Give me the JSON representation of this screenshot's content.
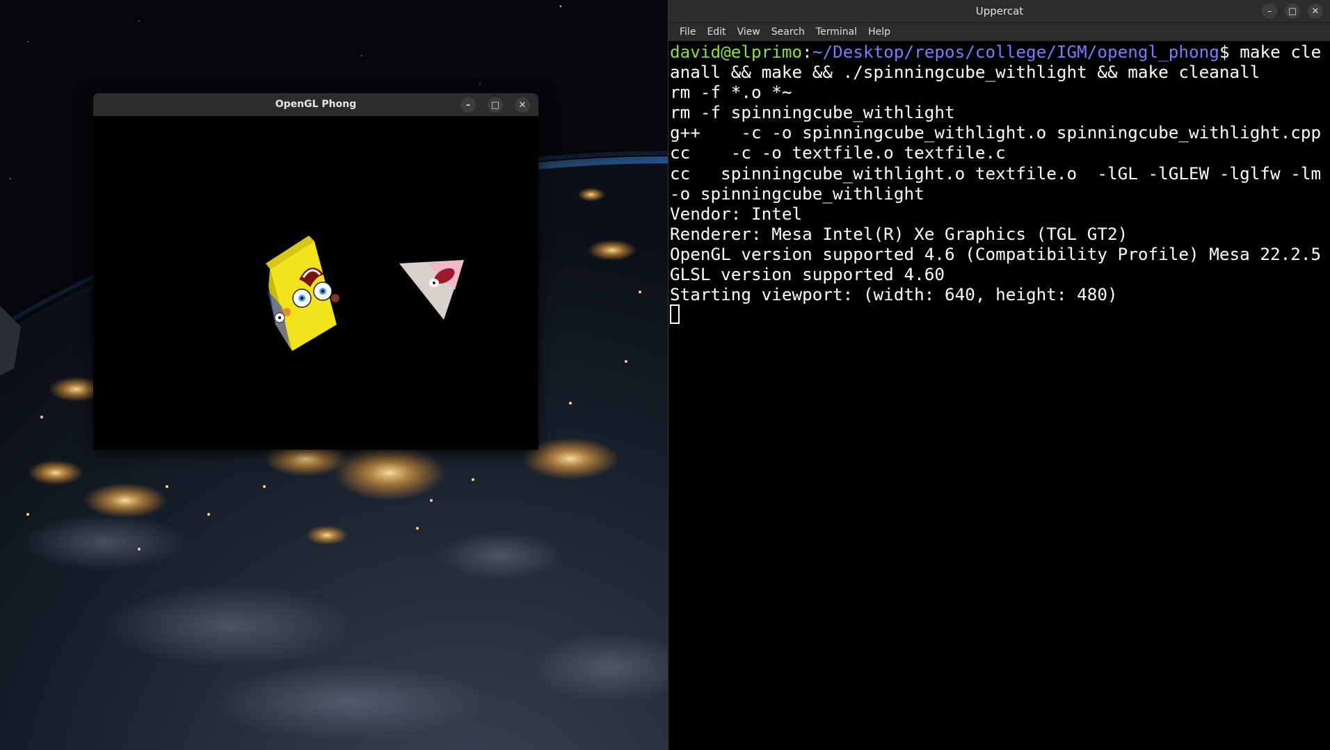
{
  "opengl_window": {
    "title": "OpenGL Phong",
    "minimize_icon": "minimize-icon",
    "maximize_icon": "maximize-icon",
    "close_icon": "close-icon"
  },
  "terminal_window": {
    "title": "Uppercat",
    "menu": [
      "File",
      "Edit",
      "View",
      "Search",
      "Terminal",
      "Help"
    ],
    "prompt": {
      "user": "david@elprimo",
      "path": "~/Desktop/repos/college/IGM/opengl_phong",
      "symbol": "$ ",
      "command": "make cleanall && make && ./spinningcube_withlight && make cleanall"
    },
    "output_lines": [
      "rm -f *.o *~",
      "rm -f spinningcube_withlight",
      "g++    -c -o spinningcube_withlight.o spinningcube_withlight.cpp",
      "cc    -c -o textfile.o textfile.c",
      "cc   spinningcube_withlight.o textfile.o  -lGL -lGLEW -lglfw -lm  -o spinningcube_withlight",
      "Vendor: Intel",
      "Renderer: Mesa Intel(R) Xe Graphics (TGL GT2)",
      "OpenGL version supported 4.6 (Compatibility Profile) Mesa 22.2.5",
      "GLSL version supported 4.60",
      "Starting viewport: (width: 640, height: 480)"
    ]
  },
  "colors": {
    "prompt_user": "#8ae234",
    "prompt_path": "#7b7bff",
    "terminal_bg": "#000000",
    "titlebar_bg": "#2c2c2c"
  }
}
